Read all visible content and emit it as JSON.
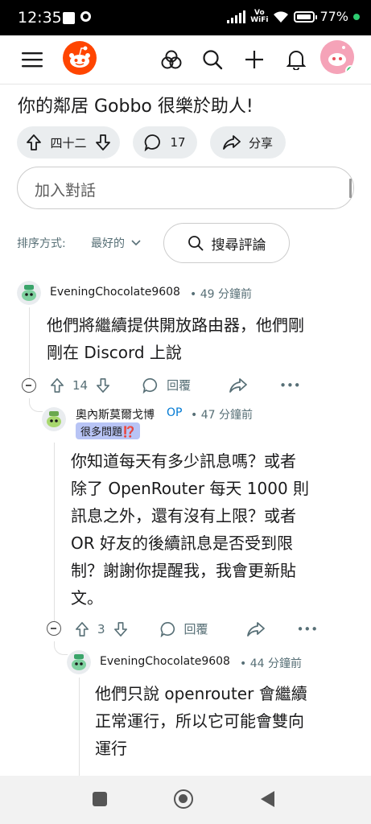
{
  "status_bar": {
    "time": "12:35",
    "network": "Vo WiFi",
    "battery": "77%"
  },
  "post": {
    "title": "你的鄰居 Gobbo 很樂於助人!",
    "votes": "四十二",
    "comment_count": "17",
    "share_label": "分享"
  },
  "reply_box": {
    "placeholder": "加入對話"
  },
  "sort": {
    "label": "排序方式:",
    "value": "最好的"
  },
  "search_comments": {
    "label": "搜尋評論"
  },
  "comments": [
    {
      "author": "EveningChocolate9608",
      "time": "• 49 分鐘前",
      "lines": [
        "他們將繼續提供開放路由器，他們剛",
        "剛在 Discord 上說"
      ],
      "votes": "14",
      "reply_label": "回覆"
    },
    {
      "author": "奧內斯莫爾戈博",
      "op_badge": "OP",
      "time": "• 47 分鐘前",
      "flair": "很多問題⁉️",
      "lines": [
        "你知道每天有多少訊息嗎？或者",
        "除了 OpenRouter 每天 1000 則",
        "訊息之外，還有沒有上限？或者",
        "OR 好友的後續訊息是否受到限",
        "制？謝謝你提醒我，我會更新貼",
        "文。"
      ],
      "votes": "3",
      "reply_label": "回覆"
    },
    {
      "author": "EveningChocolate9608",
      "time": "• 44 分鐘前",
      "lines": [
        "他們只說 openrouter 會繼續",
        "正常運行，所以它可能會雙向",
        "運行"
      ]
    }
  ],
  "more_label": "•••",
  "colors": {
    "accent": "#ff4500",
    "pill_bg": "#eaedef",
    "flair_bg": "#b8c4f5",
    "op": "#0079d3"
  }
}
